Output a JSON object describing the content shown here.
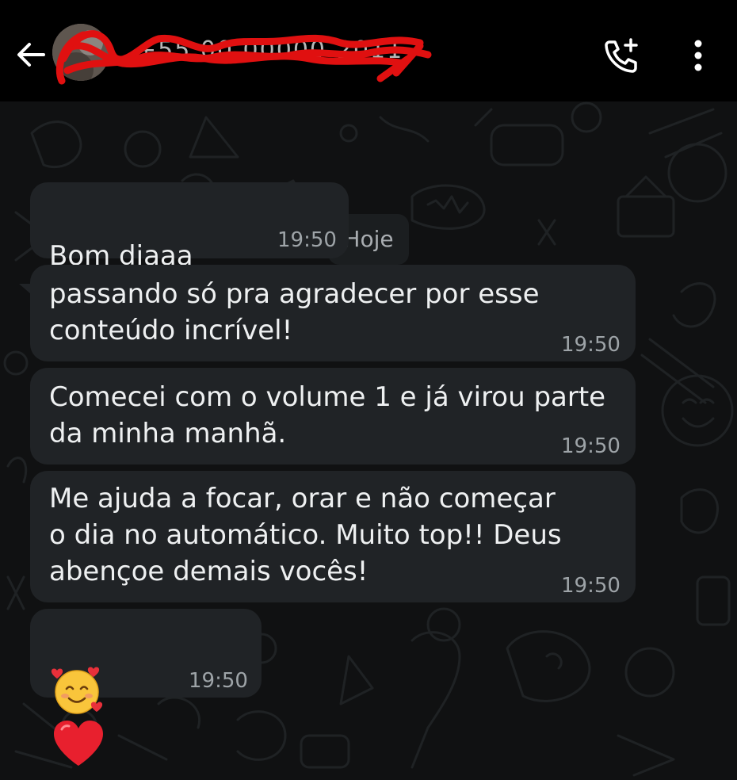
{
  "header": {
    "contact_name": "+55 00 00000-2011",
    "icons": {
      "back": "arrow-left-icon",
      "add_call": "phone-plus-icon",
      "menu": "more-vertical-icon"
    }
  },
  "chat": {
    "date_label": "Hoje",
    "messages": [
      {
        "text": "Bom diaaa",
        "time": "19:50"
      },
      {
        "text": "passando só pra agradecer por esse\nconteúdo incrível!",
        "time": "19:50"
      },
      {
        "text": "Comecei com o volume 1 e já virou parte\nda minha manhã.",
        "time": "19:50"
      },
      {
        "text": "Me ajuda a focar, orar e não começar\no dia no automático. Muito top!! Deus\nabençoe demais vocês!",
        "time": "19:50"
      },
      {
        "text": "",
        "time": "19:50"
      }
    ]
  },
  "colors": {
    "header_bg": "#000000",
    "chat_bg": "#101112",
    "bubble_bg": "#202326",
    "text": "#eef0f1",
    "time": "#9ea4a8",
    "redaction": "#e01010"
  }
}
